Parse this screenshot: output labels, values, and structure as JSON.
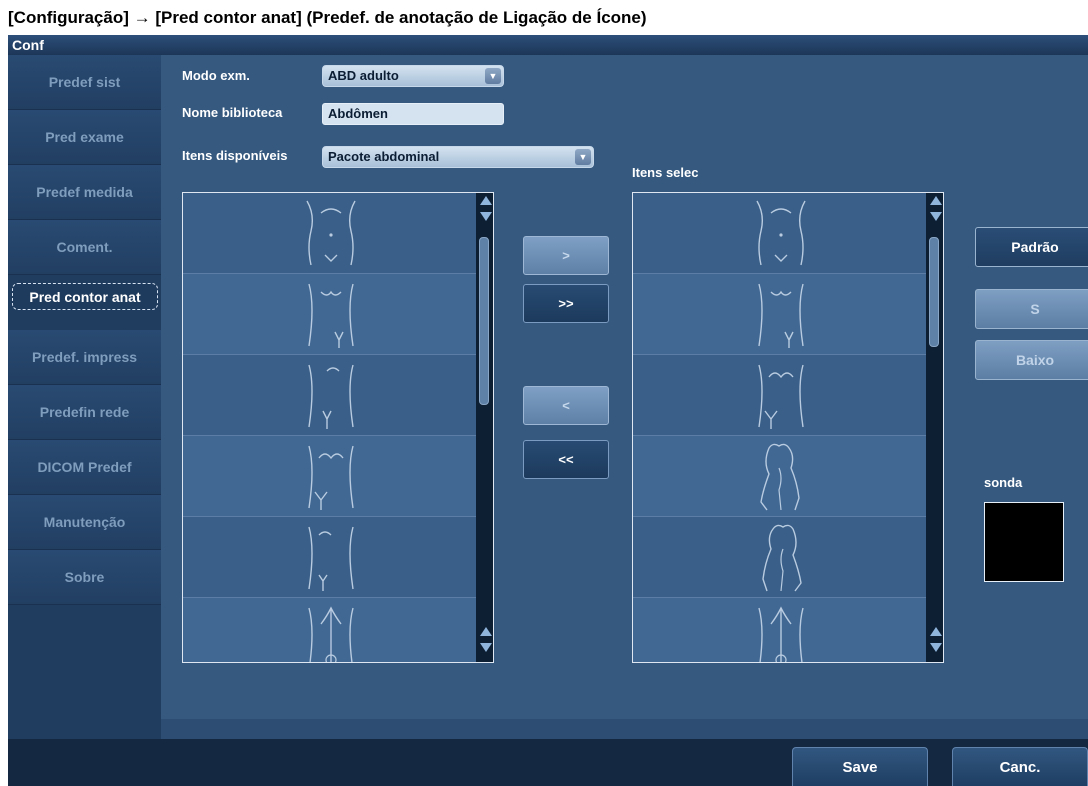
{
  "caption": "[Configuração] → [Pred contor anat] (Predef. de anotação de Ligação de Ícone)",
  "window": {
    "title": "Conf"
  },
  "sidebar": {
    "items": [
      {
        "label": "Predef sist",
        "active": false
      },
      {
        "label": "Pred exame",
        "active": false
      },
      {
        "label": "Predef medida",
        "active": false
      },
      {
        "label": "Coment.",
        "active": false
      },
      {
        "label": "Pred contor anat",
        "active": true
      },
      {
        "label": "Predef. impress",
        "active": false
      },
      {
        "label": "Predefin rede",
        "active": false
      },
      {
        "label": "DICOM Predef",
        "active": false
      },
      {
        "label": "Manutenção",
        "active": false
      },
      {
        "label": "Sobre",
        "active": false
      }
    ]
  },
  "form": {
    "exam_mode_label": "Modo exm.",
    "exam_mode_value": "ABD adulto",
    "library_name_label": "Nome biblioteca",
    "library_name_value": "Abdômen",
    "available_items_label": "Itens disponíveis",
    "available_items_value": "Pacote abdominal",
    "selected_items_label": "Itens selec"
  },
  "available_list": {
    "items": [
      "bodymark-abdomen-navel",
      "bodymark-abdomen-lower",
      "bodymark-abdomen-upper",
      "bodymark-abdomen-pelvis",
      "bodymark-abdomen-side",
      "bodymark-abdomen-midline"
    ]
  },
  "selected_list": {
    "items": [
      "bodymark-abdomen-navel",
      "bodymark-abdomen-lower",
      "bodymark-abdomen-pelvis",
      "bodymark-lateral-left",
      "bodymark-lateral-right",
      "bodymark-abdomen-midline"
    ]
  },
  "transfer": {
    "add_label": ">",
    "add_all_label": ">>",
    "remove_label": "<",
    "remove_all_label": "<<"
  },
  "actions": {
    "default_label": "Padrão",
    "up_label": "S",
    "down_label": "Baixo",
    "probe_label": "sonda"
  },
  "footer": {
    "save_label": "Save",
    "cancel_label": "Canc."
  },
  "colors": {
    "panel": "#35597f",
    "sidebar": "#203c5e",
    "text_dim": "#7f9dbd"
  }
}
